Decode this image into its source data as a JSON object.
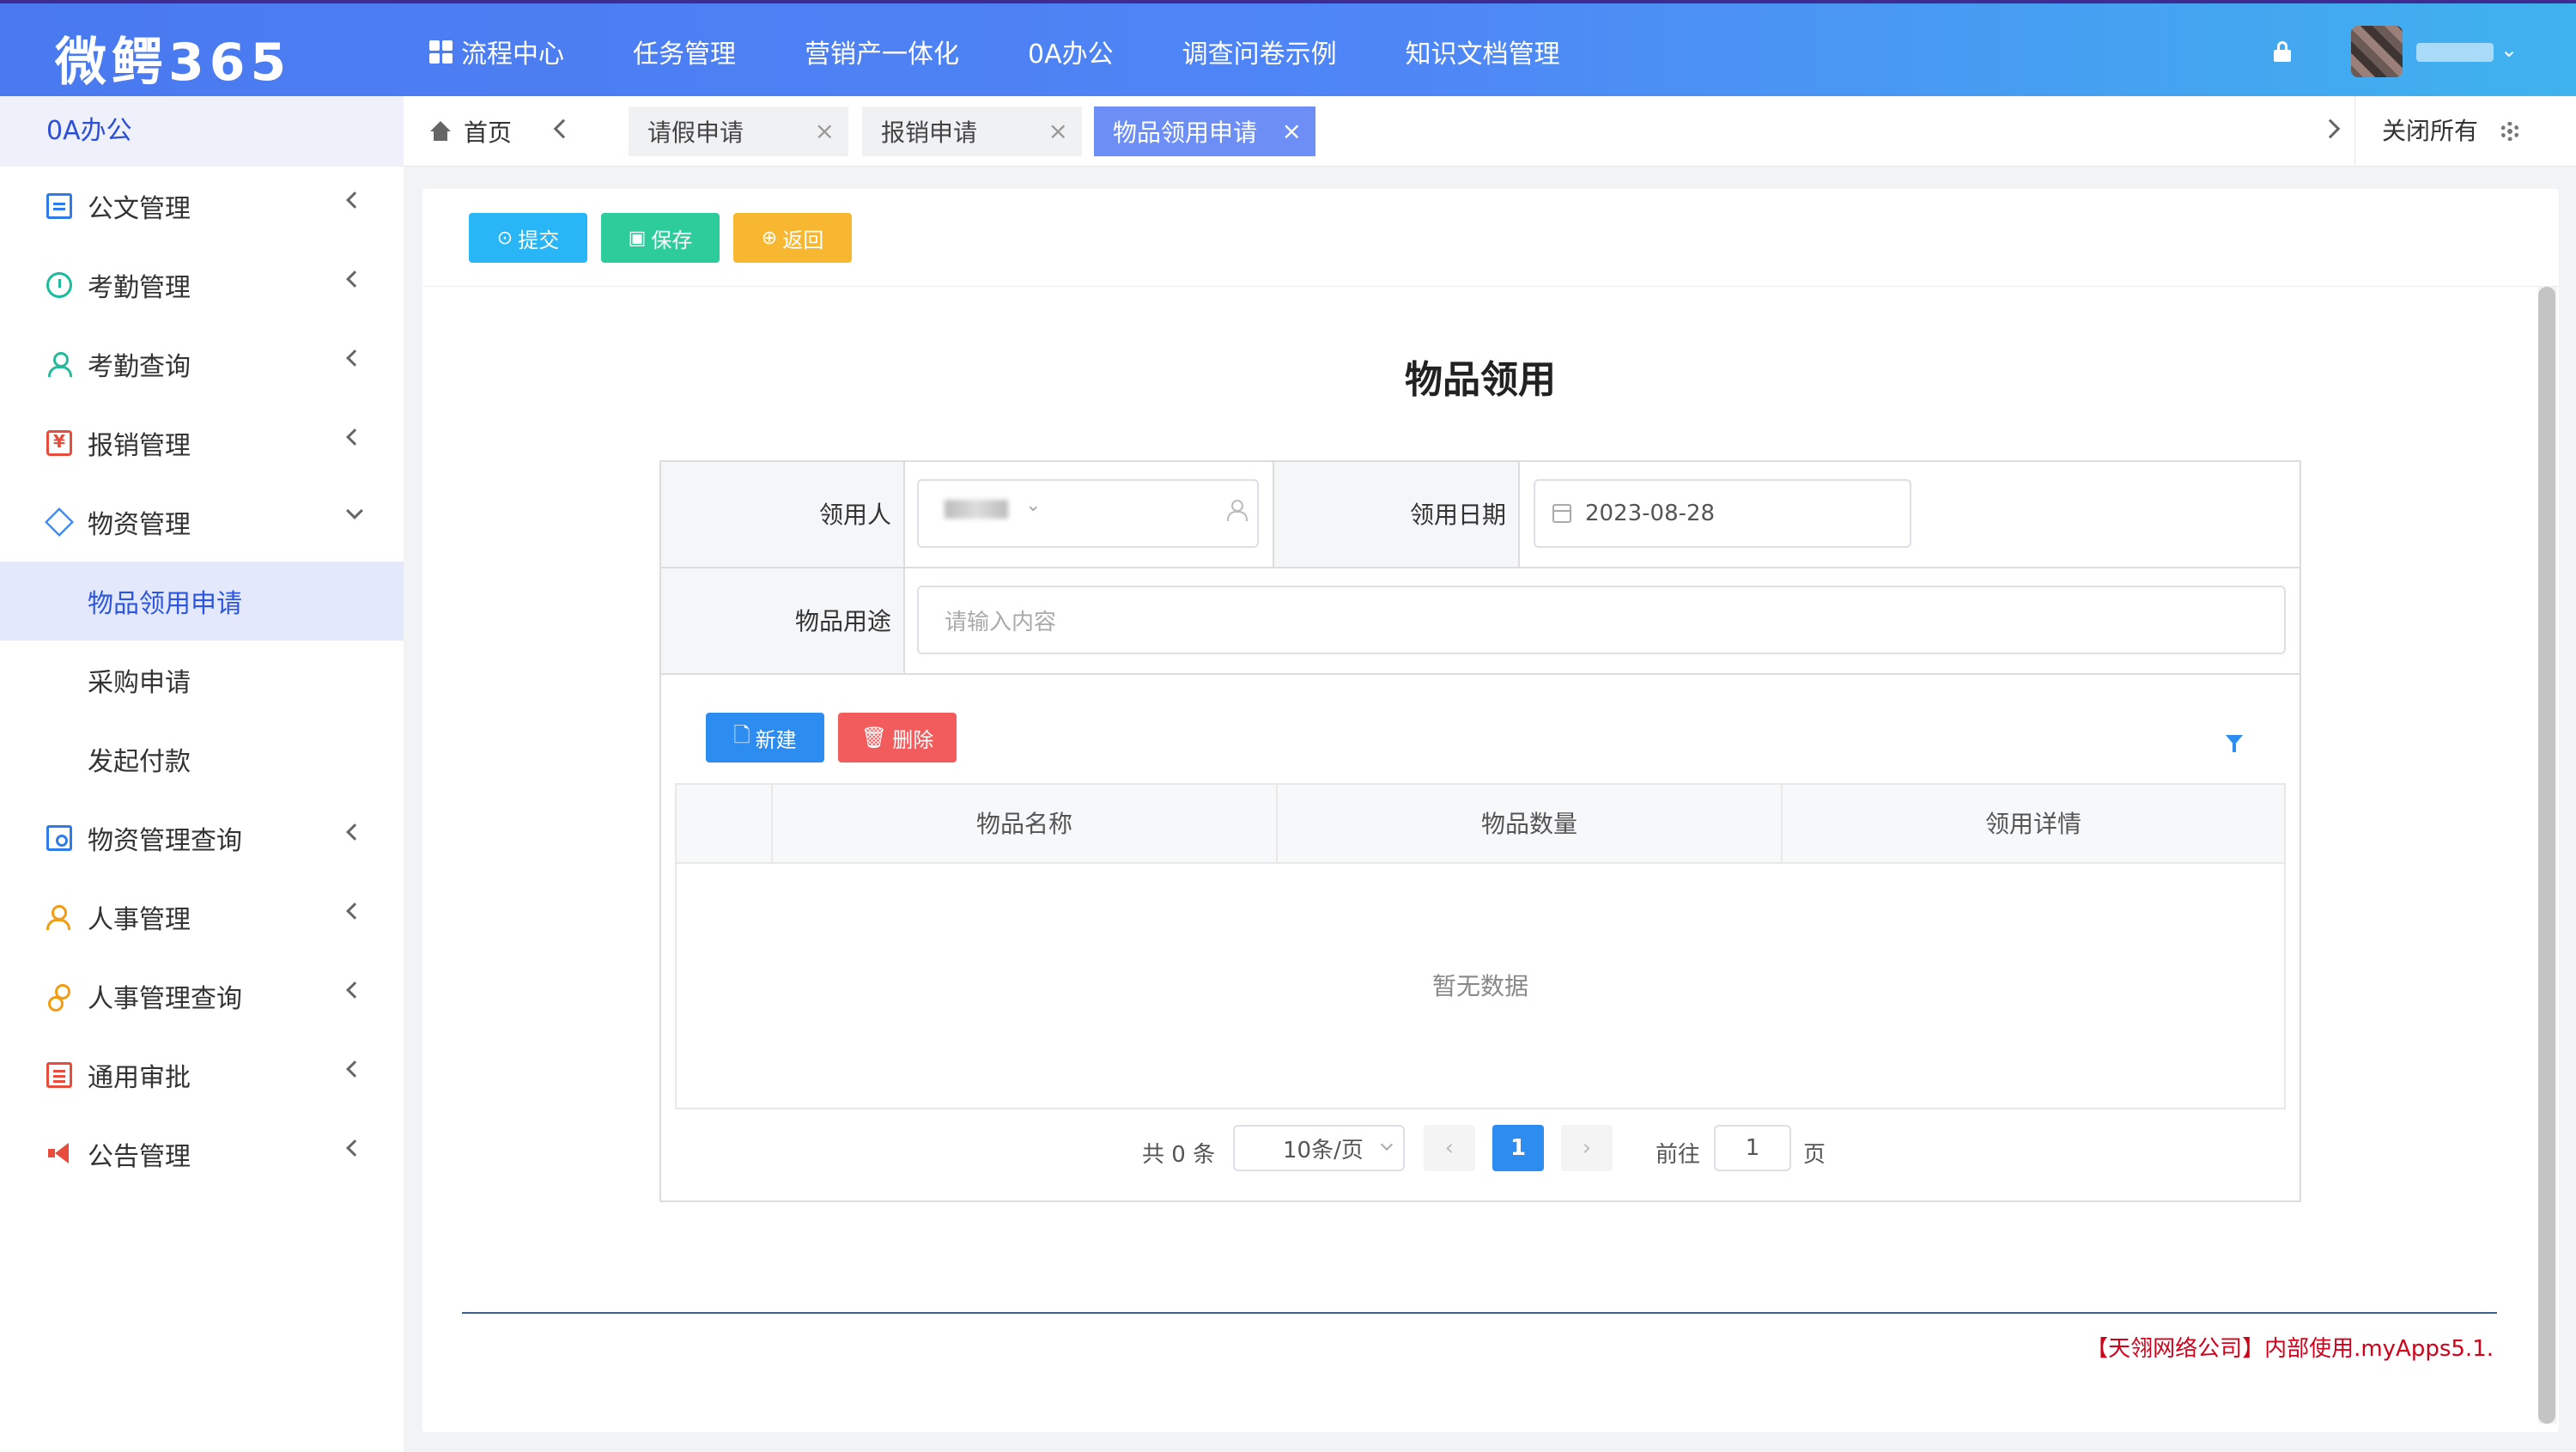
{
  "app": {
    "logo": "微鳄365"
  },
  "topnav": [
    {
      "label": "流程中心",
      "icon": "grid-icon"
    },
    {
      "label": "任务管理"
    },
    {
      "label": "营销产一体化"
    },
    {
      "label": "0A办公"
    },
    {
      "label": "调查问卷示例"
    },
    {
      "label": "知识文档管理"
    }
  ],
  "sidebar": {
    "header": "0A办公",
    "items": [
      {
        "label": "公文管理",
        "icon": "document-icon"
      },
      {
        "label": "考勤管理",
        "icon": "clock-icon"
      },
      {
        "label": "考勤查询",
        "icon": "user-icon"
      },
      {
        "label": "报销管理",
        "icon": "money-icon"
      },
      {
        "label": "物资管理",
        "icon": "box-icon",
        "expanded": true
      },
      {
        "label": "物资管理查询",
        "icon": "search-doc-icon"
      },
      {
        "label": "人事管理",
        "icon": "people-icon"
      },
      {
        "label": "人事管理查询",
        "icon": "people-search-icon"
      },
      {
        "label": "通用审批",
        "icon": "list-icon"
      },
      {
        "label": "公告管理",
        "icon": "megaphone-icon"
      }
    ],
    "subitems": [
      {
        "label": "物品领用申请",
        "active": true
      },
      {
        "label": "采购申请"
      },
      {
        "label": "发起付款"
      }
    ]
  },
  "tabs": {
    "home": "首页",
    "items": [
      {
        "label": "请假申请",
        "close": "×"
      },
      {
        "label": "报销申请",
        "close": "×"
      },
      {
        "label": "物品领用申请",
        "close": "×",
        "active": true
      }
    ],
    "close_all": "关闭所有"
  },
  "toolbar": {
    "submit": "提交",
    "save": "保存",
    "back": "返回"
  },
  "form": {
    "title": "物品领用",
    "fields": {
      "applicant_label": "领用人",
      "date_label": "领用日期",
      "date_value": "2023-08-28",
      "purpose_label": "物品用途",
      "purpose_placeholder": "请输入内容"
    },
    "subtable": {
      "new_button": "新建",
      "delete_button": "删除",
      "columns": [
        "物品名称",
        "物品数量",
        "领用详情"
      ],
      "rows": [],
      "empty_text": "暂无数据"
    },
    "pagination": {
      "total": "共 0 条",
      "page_size": "10条/页",
      "prev": "‹",
      "current": "1",
      "next": "›",
      "goto_label": "前往",
      "goto_value": "1",
      "page_suffix": "页"
    }
  },
  "footer": {
    "note": "【天翎网络公司】内部使用.myApps5.1."
  },
  "colors": {
    "topbar_start": "#4a79f0",
    "topbar_end": "#3fb3ee",
    "active_tab": "#6d8ff5",
    "submit": "#29b6f6",
    "save": "#2ecc9a",
    "back": "#f7b731",
    "new": "#2d8cf0",
    "delete": "#f25c5c",
    "footer_note": "#d0021b"
  }
}
